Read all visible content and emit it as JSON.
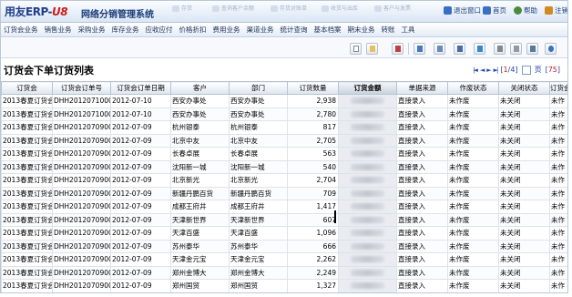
{
  "header": {
    "logo_text": "用友ERP-",
    "logo_version": "U8",
    "system_title": "网络分销管理系统",
    "faded_buttons": [
      "存货",
      "查询客户余额",
      "存货对账单",
      "收货与出库",
      "客户与发票"
    ],
    "links": [
      {
        "label": "退出窗口",
        "icon": "exit-icon",
        "color": "#3a6fc4"
      },
      {
        "label": "首页",
        "icon": "home-icon",
        "color": "#3a6fc4"
      },
      {
        "label": "帮助",
        "icon": "help-icon",
        "color": "#4a8a3a"
      },
      {
        "label": "注销",
        "icon": "logout-icon",
        "color": "#d08a20"
      }
    ]
  },
  "menu": [
    "订货会业务",
    "销售业务",
    "采购业务",
    "库存业务",
    "应收应付",
    "价格折扣",
    "费用业务",
    "渠道业务",
    "统计查询",
    "基本档案",
    "期末业务",
    "转账",
    "工具"
  ],
  "toolbar": {
    "icons": [
      "new-icon",
      "edit-icon",
      "delete-icon",
      "import-icon",
      "copy-icon",
      "filter-icon",
      "export-icon",
      "print-icon",
      "print-preview-icon",
      "settings-icon",
      "help-icon"
    ]
  },
  "list": {
    "title": "订货会下单订货列表",
    "pager": {
      "first": "|◄",
      "prev": "◄",
      "next": "►",
      "last": "►|",
      "open_bracket": "[",
      "current_page": "1",
      "slash": "/",
      "total_pages": "4",
      "close_bracket": "]",
      "page_input_value": "",
      "page_label": "页",
      "page_count_bracket_open": "[",
      "record_count": "75",
      "page_count_bracket_close": "]"
    }
  },
  "table": {
    "columns": [
      "订货会",
      "订货会订单号",
      "订货会订单日期",
      "客户",
      "部门",
      "订货数量",
      "订货金额",
      "单据来源",
      "作废状态",
      "关闭状态",
      "订货会状态"
    ],
    "rows": [
      [
        "2013春夏订货会",
        "DHH20120710000",
        "2012-07-10",
        "西安办事处",
        "西安办事处",
        "2,938",
        "",
        "直接录入",
        "未作废",
        "未关闭",
        "未作"
      ],
      [
        "2013春夏订货会",
        "DHH20120710000",
        "2012-07-10",
        "西安办事处",
        "西安办事处",
        "2,780",
        "",
        "直接录入",
        "未作废",
        "未关闭",
        "未作"
      ],
      [
        "2013春夏订货会",
        "DHH20120709001",
        "2012-07-09",
        "杭州银泰",
        "杭州银泰",
        "817",
        "",
        "直接录入",
        "未作废",
        "未关闭",
        "未作"
      ],
      [
        "2013春夏订货会",
        "DHH20120709001",
        "2012-07-09",
        "北京中友",
        "北京中友",
        "2,705",
        "",
        "直接录入",
        "未作废",
        "未关闭",
        "未作"
      ],
      [
        "2013春夏订货会",
        "DHH20120709001",
        "2012-07-09",
        "长春卓展",
        "长春卓展",
        "563",
        "",
        "直接录入",
        "未作废",
        "未关闭",
        "未作"
      ],
      [
        "2013春夏订货会",
        "DHH20120709001",
        "2012-07-09",
        "沈阳新一城",
        "沈阳新一城",
        "540",
        "",
        "直接录入",
        "未作废",
        "未关闭",
        "未作"
      ],
      [
        "2013春夏订货会",
        "DHH20120709001",
        "2012-07-09",
        "北京新光",
        "北京新光",
        "2,704",
        "",
        "直接录入",
        "未作废",
        "未关闭",
        "未作"
      ],
      [
        "2013春夏订货会",
        "DHH20120709001",
        "2012-07-09",
        "新疆丹鹏百货",
        "新疆丹鹏百货",
        "709",
        "",
        "直接录入",
        "未作废",
        "未关闭",
        "未作"
      ],
      [
        "2013春夏订货会",
        "DHH20120709001",
        "2012-07-09",
        "成都王府井",
        "成都王府井",
        "1,417",
        "",
        "直接录入",
        "未作废",
        "未关闭",
        "未作"
      ],
      [
        "2013春夏订货会",
        "DHH20120709001",
        "2012-07-09",
        "天津新世界",
        "天津新世界",
        "607",
        "",
        "直接录入",
        "未作废",
        "未关闭",
        "未作"
      ],
      [
        "2013春夏订货会",
        "DHH20120709001",
        "2012-07-09",
        "天津百盛",
        "天津百盛",
        "1,096",
        "",
        "直接录入",
        "未作废",
        "未关闭",
        "未作"
      ],
      [
        "2013春夏订货会",
        "DHH20120709001",
        "2012-07-09",
        "苏州泰华",
        "苏州泰华",
        "666",
        "",
        "直接录入",
        "未作废",
        "未关闭",
        "未作"
      ],
      [
        "2013春夏订货会",
        "DHH20120709001",
        "2012-07-09",
        "天津金元宝",
        "天津金元宝",
        "2,262",
        "",
        "直接录入",
        "未作废",
        "未关闭",
        "未作"
      ],
      [
        "2013春夏订货会",
        "DHH20120709001",
        "2012-07-09",
        "郑州金博大",
        "郑州金博大",
        "2,249",
        "",
        "直接录入",
        "未作废",
        "未关闭",
        "未作"
      ],
      [
        "2013春夏订货会",
        "DHH20120709001",
        "2012-07-09",
        "郑州国贸",
        "郑州国贸",
        "1,327",
        "",
        "直接录入",
        "未作废",
        "未关闭",
        "未作"
      ]
    ]
  }
}
